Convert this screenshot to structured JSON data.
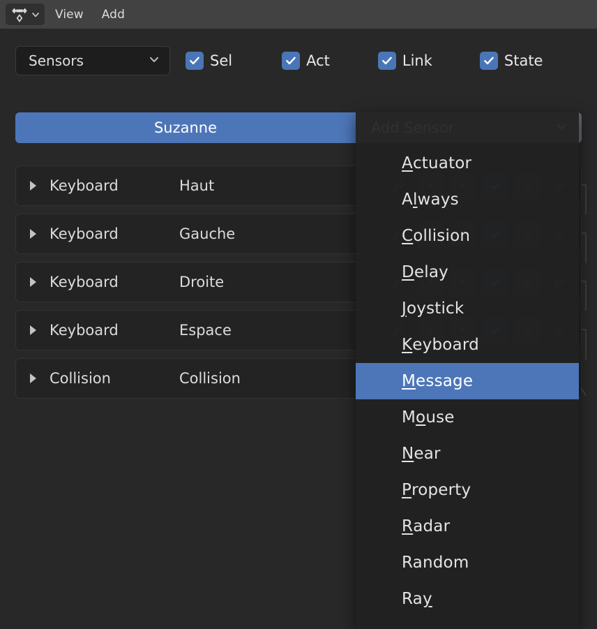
{
  "topbar": {
    "editor_type_icon": "logic-editor-icon",
    "editor_type_chevron": "chevron-down-icon",
    "menus": [
      {
        "label": "View"
      },
      {
        "label": "Add"
      }
    ]
  },
  "filters": {
    "type_select": {
      "value": "Sensors",
      "chevron": "chevron-down-icon"
    },
    "toggles": [
      {
        "label": "Sel",
        "checked": true
      },
      {
        "label": "Act",
        "checked": true
      },
      {
        "label": "Link",
        "checked": true
      },
      {
        "label": "State",
        "checked": true
      }
    ]
  },
  "object_header": {
    "object_name": "Suzanne",
    "add_button_label": "Add Sensor",
    "add_button_chevron": "chevron-down-icon"
  },
  "sensors": {
    "columns": [
      "expand",
      "type",
      "name",
      "controls"
    ],
    "rows": [
      {
        "expand_icon": "triangle-right-icon",
        "type": "Keyboard",
        "name": "Haut"
      },
      {
        "expand_icon": "triangle-right-icon",
        "type": "Keyboard",
        "name": "Gauche"
      },
      {
        "expand_icon": "triangle-right-icon",
        "type": "Keyboard",
        "name": "Droite"
      },
      {
        "expand_icon": "triangle-right-icon",
        "type": "Keyboard",
        "name": "Espace"
      },
      {
        "expand_icon": "triangle-right-icon",
        "type": "Collision",
        "name": "Collision"
      }
    ],
    "row_controls": [
      {
        "icon": "pin-icon"
      },
      {
        "icon": "arrow-up-icon"
      },
      {
        "icon": "arrow-down-icon"
      },
      {
        "icon": "checkmark-icon"
      },
      {
        "icon": "close-x-icon"
      },
      {
        "icon": "link-chain-icon"
      }
    ]
  },
  "add_sensor_menu": {
    "selected": "Message",
    "items": [
      {
        "label": "Actuator",
        "accel": "A",
        "accel_index": 0
      },
      {
        "label": "Always",
        "accel": "l",
        "accel_index": 1
      },
      {
        "label": "Collision",
        "accel": "C",
        "accel_index": 0
      },
      {
        "label": "Delay",
        "accel": "D",
        "accel_index": 0
      },
      {
        "label": "Joystick",
        "accel": "J",
        "accel_index": 0
      },
      {
        "label": "Keyboard",
        "accel": "K",
        "accel_index": 0
      },
      {
        "label": "Message",
        "accel": "M",
        "accel_index": 0,
        "selected": true
      },
      {
        "label": "Mouse",
        "accel": "o",
        "accel_index": 1
      },
      {
        "label": "Near",
        "accel": "N",
        "accel_index": 0
      },
      {
        "label": "Property",
        "accel": "P",
        "accel_index": 0
      },
      {
        "label": "Radar",
        "accel": "R",
        "accel_index": 0
      },
      {
        "label": "Random",
        "accel": "",
        "accel_index": -1
      },
      {
        "label": "Ray",
        "accel": "y",
        "accel_index": 2
      }
    ]
  },
  "colors": {
    "accent_blue": "#4d76b8",
    "checkbox_blue": "#4a76b8",
    "header_bar": "#424242",
    "panel_bg": "#282828",
    "row_bg": "#232323",
    "menu_bg": "#212121",
    "add_button_gray": "#656a72"
  }
}
